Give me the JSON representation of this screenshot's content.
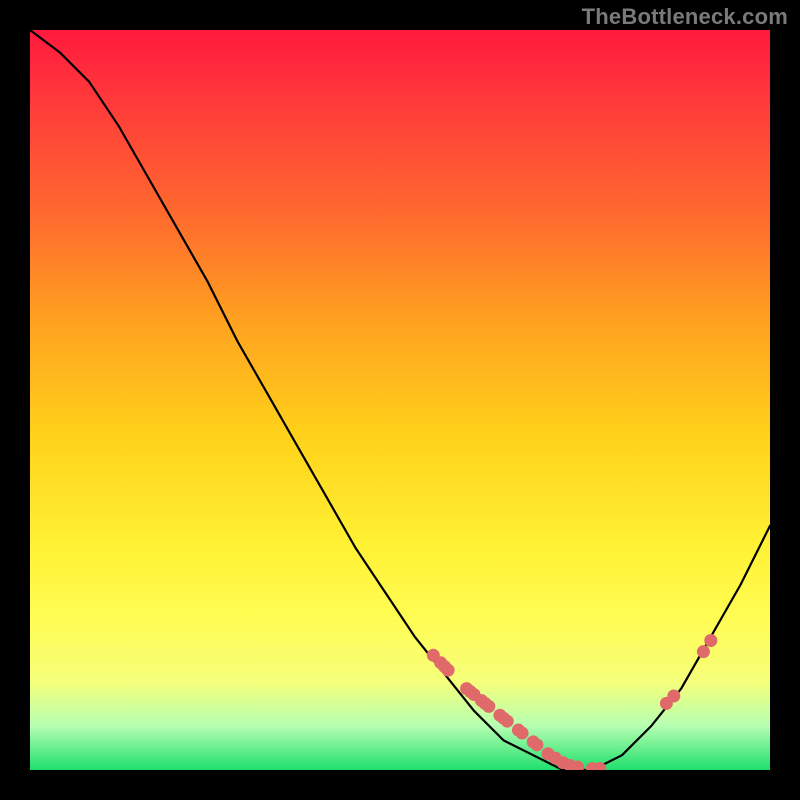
{
  "watermark": "TheBottleneck.com",
  "colors": {
    "background": "#000000",
    "gradient_top": "#ff1a3d",
    "gradient_bottom": "#1fdf6e",
    "curve": "#000000",
    "dots": "#e06a6a"
  },
  "chart_data": {
    "type": "line",
    "title": "",
    "xlabel": "",
    "ylabel": "",
    "xlim": [
      0,
      1
    ],
    "ylim": [
      0,
      1
    ],
    "curve": {
      "x": [
        0.0,
        0.04,
        0.08,
        0.12,
        0.16,
        0.2,
        0.24,
        0.28,
        0.32,
        0.36,
        0.4,
        0.44,
        0.48,
        0.52,
        0.56,
        0.6,
        0.64,
        0.68,
        0.72,
        0.76,
        0.8,
        0.84,
        0.88,
        0.92,
        0.96,
        1.0
      ],
      "y": [
        1.0,
        0.97,
        0.93,
        0.87,
        0.8,
        0.73,
        0.66,
        0.58,
        0.51,
        0.44,
        0.37,
        0.3,
        0.24,
        0.18,
        0.13,
        0.08,
        0.04,
        0.02,
        0.0,
        0.0,
        0.02,
        0.06,
        0.11,
        0.18,
        0.25,
        0.33
      ]
    },
    "scatter": {
      "x": [
        0.545,
        0.555,
        0.56,
        0.565,
        0.59,
        0.595,
        0.6,
        0.61,
        0.615,
        0.62,
        0.635,
        0.64,
        0.645,
        0.66,
        0.665,
        0.68,
        0.685,
        0.7,
        0.71,
        0.72,
        0.73,
        0.74,
        0.76,
        0.77,
        0.86,
        0.87,
        0.91,
        0.92
      ],
      "y": [
        0.155,
        0.145,
        0.14,
        0.135,
        0.11,
        0.106,
        0.102,
        0.094,
        0.09,
        0.086,
        0.074,
        0.07,
        0.066,
        0.054,
        0.05,
        0.038,
        0.034,
        0.022,
        0.016,
        0.01,
        0.006,
        0.004,
        0.002,
        0.002,
        0.09,
        0.1,
        0.16,
        0.175
      ]
    }
  }
}
